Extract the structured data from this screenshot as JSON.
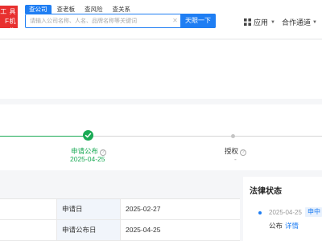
{
  "logo": {
    "line1": "工 具",
    "line2": "F机构"
  },
  "search": {
    "tabs": [
      "查公司",
      "查老板",
      "查风险",
      "查关系"
    ],
    "active_tab": 0,
    "placeholder": "请输入公司名称、人名、品牌名称等关键词",
    "button_label": "天眼一下"
  },
  "nav": {
    "apps_label": "应用",
    "coop_label": "合作通道"
  },
  "timeline": {
    "steps": [
      {
        "label": "申请公布",
        "date": "2025-04-25",
        "status": "done"
      },
      {
        "label": "授权",
        "date": "-",
        "status": "pending"
      }
    ]
  },
  "info_table": {
    "rows": [
      {
        "key": "申请日",
        "value": "2025-02-27"
      },
      {
        "key": "申请公布日",
        "value": "2025-04-25"
      }
    ]
  },
  "legal_status": {
    "title": "法律状态",
    "entries": [
      {
        "date": "2025-04-25",
        "tag": "申中",
        "text": "公布",
        "link": "详情"
      }
    ]
  },
  "colors": {
    "primary": "#1f7ef3",
    "success": "#1aaa55",
    "brand_red": "#e8302f"
  }
}
